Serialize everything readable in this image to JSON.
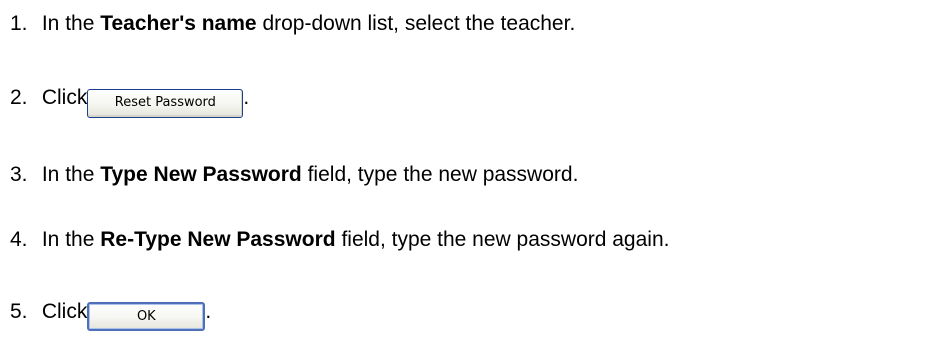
{
  "steps": [
    {
      "number": "1.",
      "prefix": "In the",
      "bold": "Teacher's name",
      "suffix": "drop-down list, select the teacher."
    },
    {
      "number": "2.",
      "prefix": "Click",
      "button_label": "Reset Password",
      "suffix": "."
    },
    {
      "number": "3.",
      "prefix": "In the",
      "bold": "Type New Password",
      "suffix": "field, type the new password."
    },
    {
      "number": "4.",
      "prefix": "In the",
      "bold": "Re-Type New Password",
      "suffix": "field, type the new password again."
    },
    {
      "number": "5.",
      "prefix": "Click",
      "button_label": "OK",
      "suffix": "."
    }
  ]
}
